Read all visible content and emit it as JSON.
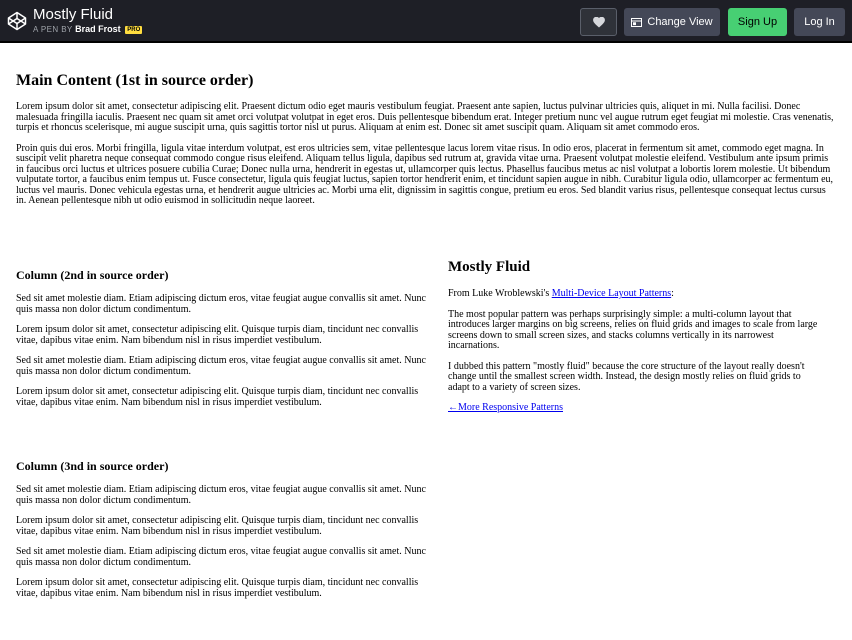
{
  "header": {
    "title": "Mostly Fluid",
    "byline_prefix": "A PEN BY",
    "author": "Brad Frost",
    "pro_badge": "PRO",
    "heart_icon": "heart-icon",
    "change_view_label": "Change View",
    "signup_label": "Sign Up",
    "login_label": "Log In",
    "colors": {
      "bar": "#1e1f26",
      "signup": "#47cf73",
      "pro": "#ffdd40",
      "button": "#444857"
    }
  },
  "main": {
    "heading": "Main Content (1st in source order)",
    "paragraphs": [
      "Lorem ipsum dolor sit amet, consectetur adipiscing elit. Praesent dictum odio eget mauris vestibulum feugiat. Praesent ante sapien, luctus pulvinar ultricies quis, aliquet in mi. Nulla facilisi. Donec malesuada fringilla iaculis. Praesent nec quam sit amet orci volutpat volutpat in eget eros. Duis pellentesque bibendum erat. Integer pretium nunc vel augue rutrum eget feugiat mi molestie. Cras venenatis, turpis et rhoncus scelerisque, mi augue suscipit urna, quis sagittis tortor nisl ut purus. Aliquam at enim est. Donec sit amet suscipit quam. Aliquam sit amet commodo eros.",
      "Proin quis dui eros. Morbi fringilla, ligula vitae interdum volutpat, est eros ultricies sem, vitae pellentesque lacus lorem vitae risus. In odio eros, placerat in fermentum sit amet, commodo eget magna. In suscipit velit pharetra neque consequat commodo congue risus eleifend. Aliquam tellus ligula, dapibus sed rutrum at, gravida vitae urna. Praesent volutpat molestie eleifend. Vestibulum ante ipsum primis in faucibus orci luctus et ultrices posuere cubilia Curae; Donec nulla urna, hendrerit in egestas ut, ullamcorper quis lectus. Phasellus faucibus metus ac nisl volutpat a lobortis lorem molestie. Ut bibendum vulputate tortor, a faucibus enim tempus ut. Fusce consectetur, ligula quis feugiat luctus, sapien tortor hendrerit enim, et tincidunt sapien augue in nibh. Curabitur ligula odio, ullamcorper ac fermentum eu, luctus vel mauris. Donec vehicula egestas urna, et hendrerit augue ultricies ac. Morbi urna elit, dignissim in sagittis congue, pretium eu eros. Sed blandit varius risus, pellentesque consequat lectus cursus in. Aenean pellentesque nibh ut odio euismod in sollicitudin neque laoreet."
    ]
  },
  "column2": {
    "heading": "Column (2nd in source order)",
    "paragraphs": [
      "Sed sit amet molestie diam. Etiam adipiscing dictum eros, vitae feugiat augue convallis sit amet. Nunc quis massa non dolor dictum condimentum.",
      "Lorem ipsum dolor sit amet, consectetur adipiscing elit. Quisque turpis diam, tincidunt nec convallis vitae, dapibus vitae enim. Nam bibendum nisl in risus imperdiet vestibulum.",
      "Sed sit amet molestie diam. Etiam adipiscing dictum eros, vitae feugiat augue convallis sit amet. Nunc quis massa non dolor dictum condimentum.",
      "Lorem ipsum dolor sit amet, consectetur adipiscing elit. Quisque turpis diam, tincidunt nec convallis vitae, dapibus vitae enim. Nam bibendum nisl in risus imperdiet vestibulum."
    ]
  },
  "column3": {
    "heading": "Column (3nd in source order)",
    "paragraphs": [
      "Sed sit amet molestie diam. Etiam adipiscing dictum eros, vitae feugiat augue convallis sit amet. Nunc quis massa non dolor dictum condimentum.",
      "Lorem ipsum dolor sit amet, consectetur adipiscing elit. Quisque turpis diam, tincidunt nec convallis vitae, dapibus vitae enim. Nam bibendum nisl in risus imperdiet vestibulum.",
      "Sed sit amet molestie diam. Etiam adipiscing dictum eros, vitae feugiat augue convallis sit amet. Nunc quis massa non dolor dictum condimentum.",
      "Lorem ipsum dolor sit amet, consectetur adipiscing elit. Quisque turpis diam, tincidunt nec convallis vitae, dapibus vitae enim. Nam bibendum nisl in risus imperdiet vestibulum."
    ]
  },
  "aside": {
    "heading": "Mostly Fluid",
    "intro_prefix": "From Luke Wroblewski's ",
    "intro_link": "Multi-Device Layout Patterns",
    "intro_suffix": ":",
    "paragraph1": "The most popular pattern was perhaps surprisingly simple: a multi-column layout that introduces larger margins on big screens, relies on fluid grids and images to scale from large screens down to small screen sizes, and stacks columns vertically in its narrowest incarnations.",
    "paragraph2": "I dubbed this pattern \"mostly fluid\" because the core structure of the layout really doesn't change until the smallest screen width. Instead, the design mostly relies on fluid grids to adapt to a variety of screen sizes.",
    "more_link": "←More Responsive Patterns"
  }
}
